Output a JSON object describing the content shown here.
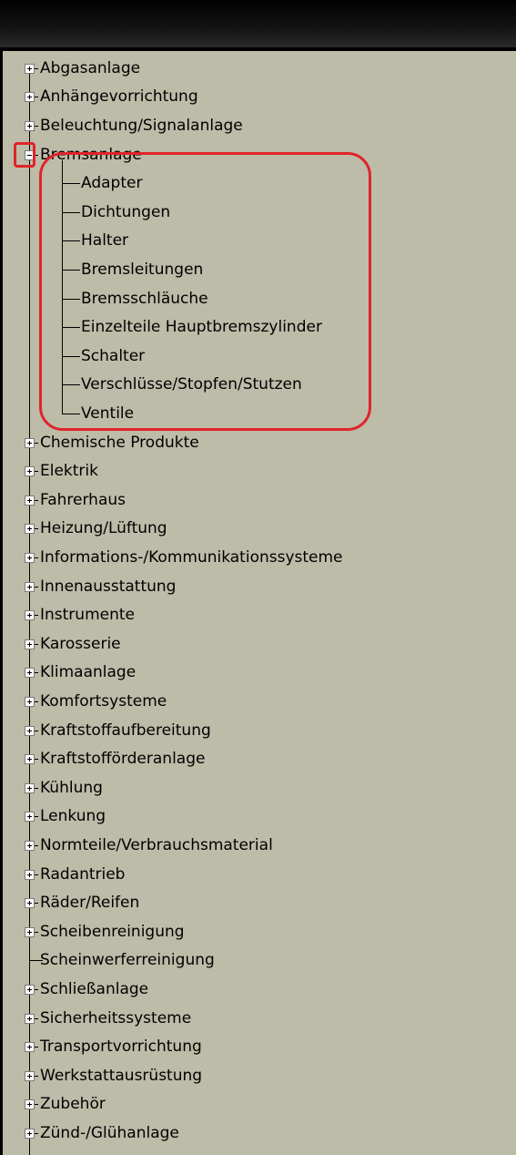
{
  "tree": {
    "items": [
      {
        "label": "Abgasanlage",
        "expander": "plus"
      },
      {
        "label": "Anhängevorrichtung",
        "expander": "plus"
      },
      {
        "label": "Beleuchtung/Signalanlage",
        "expander": "plus"
      },
      {
        "label": "Bremsanlage",
        "expander": "minus",
        "expanded": true,
        "children": [
          {
            "label": "Adapter"
          },
          {
            "label": "Dichtungen"
          },
          {
            "label": "Halter"
          },
          {
            "label": "Bremsleitungen"
          },
          {
            "label": "Bremsschläuche"
          },
          {
            "label": "Einzelteile Hauptbremszylinder"
          },
          {
            "label": "Schalter"
          },
          {
            "label": "Verschlüsse/Stopfen/Stutzen"
          },
          {
            "label": "Ventile"
          }
        ]
      },
      {
        "label": "Chemische Produkte",
        "expander": "plus"
      },
      {
        "label": "Elektrik",
        "expander": "plus"
      },
      {
        "label": "Fahrerhaus",
        "expander": "plus"
      },
      {
        "label": "Heizung/Lüftung",
        "expander": "plus"
      },
      {
        "label": "Informations-/Kommunikationssysteme",
        "expander": "plus"
      },
      {
        "label": "Innenausstattung",
        "expander": "plus"
      },
      {
        "label": "Instrumente",
        "expander": "plus"
      },
      {
        "label": "Karosserie",
        "expander": "plus"
      },
      {
        "label": "Klimaanlage",
        "expander": "plus"
      },
      {
        "label": "Komfortsysteme",
        "expander": "plus"
      },
      {
        "label": "Kraftstoffaufbereitung",
        "expander": "plus"
      },
      {
        "label": "Kraftstofförderanlage",
        "expander": "plus"
      },
      {
        "label": "Kühlung",
        "expander": "plus"
      },
      {
        "label": "Lenkung",
        "expander": "plus"
      },
      {
        "label": "Normteile/Verbrauchsmaterial",
        "expander": "plus"
      },
      {
        "label": "Radantrieb",
        "expander": "plus"
      },
      {
        "label": "Räder/Reifen",
        "expander": "plus"
      },
      {
        "label": "Scheibenreinigung",
        "expander": "plus"
      },
      {
        "label": "Scheinwerferreinigung",
        "expander": "none"
      },
      {
        "label": "Schließanlage",
        "expander": "plus"
      },
      {
        "label": "Sicherheitssysteme",
        "expander": "plus"
      },
      {
        "label": "Transportvorrichtung",
        "expander": "plus"
      },
      {
        "label": "Werkstattausrüstung",
        "expander": "plus"
      },
      {
        "label": "Zubehör",
        "expander": "plus"
      },
      {
        "label": "Zünd-/Glühanlage",
        "expander": "plus"
      }
    ]
  },
  "colors": {
    "pane_background": "#bdbca8",
    "titlebar": "#141414",
    "highlight": "#e0242b"
  }
}
